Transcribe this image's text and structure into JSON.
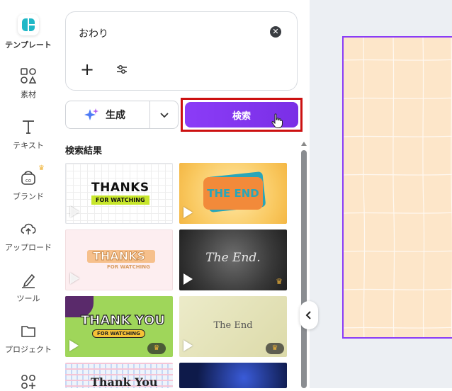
{
  "rail": {
    "items": [
      {
        "label": "テンプレート",
        "icon": "template-icon"
      },
      {
        "label": "素材",
        "icon": "elements-icon"
      },
      {
        "label": "テキスト",
        "icon": "text-icon"
      },
      {
        "label": "ブランド",
        "icon": "brand-icon"
      },
      {
        "label": "アップロード",
        "icon": "upload-icon"
      },
      {
        "label": "ツール",
        "icon": "draw-tool-icon"
      },
      {
        "label": "プロジェクト",
        "icon": "folder-icon"
      },
      {
        "label": "",
        "icon": "apps-icon"
      }
    ]
  },
  "search": {
    "value": "おわり",
    "clear_icon": "close-icon",
    "add_icon": "plus-icon",
    "filter_icon": "filter-icon"
  },
  "actions": {
    "generate_label": "生成",
    "search_label": "検索"
  },
  "results": {
    "title": "検索結果",
    "thumbnails": [
      {
        "text": "THANKS",
        "subtext": "FOR WATCHING",
        "premium": false
      },
      {
        "text": "THE END",
        "subtext": "",
        "premium": false
      },
      {
        "text": "THANKS",
        "subtext": "FOR WATCHING",
        "premium": false
      },
      {
        "text": "The End.",
        "subtext": "",
        "premium": true
      },
      {
        "text": "THANK YOU",
        "subtext": "FOR WATCHING",
        "premium": true
      },
      {
        "text": "The End",
        "subtext": "",
        "premium": true
      },
      {
        "text": "Thank You",
        "subtext": "",
        "premium": false
      },
      {
        "text": "",
        "subtext": "",
        "premium": false
      }
    ]
  },
  "colors": {
    "accent": "#8b3cf7",
    "highlight": "#cc1111",
    "canvas_page": "#fde6c9"
  }
}
